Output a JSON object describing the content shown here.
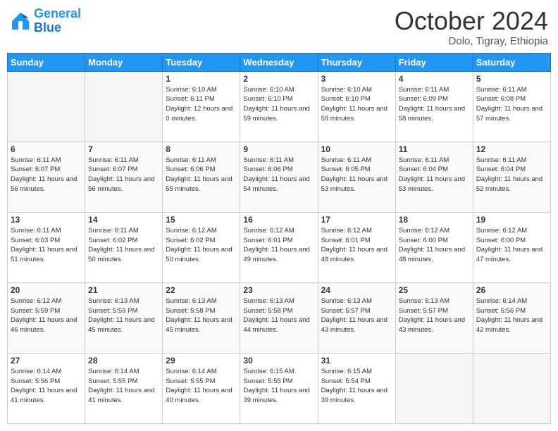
{
  "logo": {
    "line1": "General",
    "line2": "Blue"
  },
  "header": {
    "month": "October 2024",
    "location": "Dolo, Tigray, Ethiopia"
  },
  "days": [
    "Sunday",
    "Monday",
    "Tuesday",
    "Wednesday",
    "Thursday",
    "Friday",
    "Saturday"
  ],
  "weeks": [
    [
      {
        "day": "",
        "info": ""
      },
      {
        "day": "",
        "info": ""
      },
      {
        "day": "1",
        "info": "Sunrise: 6:10 AM\nSunset: 6:11 PM\nDaylight: 12 hours and 0 minutes."
      },
      {
        "day": "2",
        "info": "Sunrise: 6:10 AM\nSunset: 6:10 PM\nDaylight: 11 hours and 59 minutes."
      },
      {
        "day": "3",
        "info": "Sunrise: 6:10 AM\nSunset: 6:10 PM\nDaylight: 11 hours and 59 minutes."
      },
      {
        "day": "4",
        "info": "Sunrise: 6:11 AM\nSunset: 6:09 PM\nDaylight: 11 hours and 58 minutes."
      },
      {
        "day": "5",
        "info": "Sunrise: 6:11 AM\nSunset: 6:08 PM\nDaylight: 11 hours and 57 minutes."
      }
    ],
    [
      {
        "day": "6",
        "info": "Sunrise: 6:11 AM\nSunset: 6:07 PM\nDaylight: 11 hours and 56 minutes."
      },
      {
        "day": "7",
        "info": "Sunrise: 6:11 AM\nSunset: 6:07 PM\nDaylight: 11 hours and 56 minutes."
      },
      {
        "day": "8",
        "info": "Sunrise: 6:11 AM\nSunset: 6:06 PM\nDaylight: 11 hours and 55 minutes."
      },
      {
        "day": "9",
        "info": "Sunrise: 6:11 AM\nSunset: 6:06 PM\nDaylight: 11 hours and 54 minutes."
      },
      {
        "day": "10",
        "info": "Sunrise: 6:11 AM\nSunset: 6:05 PM\nDaylight: 11 hours and 53 minutes."
      },
      {
        "day": "11",
        "info": "Sunrise: 6:11 AM\nSunset: 6:04 PM\nDaylight: 11 hours and 53 minutes."
      },
      {
        "day": "12",
        "info": "Sunrise: 6:11 AM\nSunset: 6:04 PM\nDaylight: 11 hours and 52 minutes."
      }
    ],
    [
      {
        "day": "13",
        "info": "Sunrise: 6:11 AM\nSunset: 6:03 PM\nDaylight: 11 hours and 51 minutes."
      },
      {
        "day": "14",
        "info": "Sunrise: 6:11 AM\nSunset: 6:02 PM\nDaylight: 11 hours and 50 minutes."
      },
      {
        "day": "15",
        "info": "Sunrise: 6:12 AM\nSunset: 6:02 PM\nDaylight: 11 hours and 50 minutes."
      },
      {
        "day": "16",
        "info": "Sunrise: 6:12 AM\nSunset: 6:01 PM\nDaylight: 11 hours and 49 minutes."
      },
      {
        "day": "17",
        "info": "Sunrise: 6:12 AM\nSunset: 6:01 PM\nDaylight: 11 hours and 48 minutes."
      },
      {
        "day": "18",
        "info": "Sunrise: 6:12 AM\nSunset: 6:00 PM\nDaylight: 11 hours and 48 minutes."
      },
      {
        "day": "19",
        "info": "Sunrise: 6:12 AM\nSunset: 6:00 PM\nDaylight: 11 hours and 47 minutes."
      }
    ],
    [
      {
        "day": "20",
        "info": "Sunrise: 6:12 AM\nSunset: 5:59 PM\nDaylight: 11 hours and 46 minutes."
      },
      {
        "day": "21",
        "info": "Sunrise: 6:13 AM\nSunset: 5:59 PM\nDaylight: 11 hours and 45 minutes."
      },
      {
        "day": "22",
        "info": "Sunrise: 6:13 AM\nSunset: 5:58 PM\nDaylight: 11 hours and 45 minutes."
      },
      {
        "day": "23",
        "info": "Sunrise: 6:13 AM\nSunset: 5:58 PM\nDaylight: 11 hours and 44 minutes."
      },
      {
        "day": "24",
        "info": "Sunrise: 6:13 AM\nSunset: 5:57 PM\nDaylight: 11 hours and 43 minutes."
      },
      {
        "day": "25",
        "info": "Sunrise: 6:13 AM\nSunset: 5:57 PM\nDaylight: 11 hours and 43 minutes."
      },
      {
        "day": "26",
        "info": "Sunrise: 6:14 AM\nSunset: 5:56 PM\nDaylight: 11 hours and 42 minutes."
      }
    ],
    [
      {
        "day": "27",
        "info": "Sunrise: 6:14 AM\nSunset: 5:56 PM\nDaylight: 11 hours and 41 minutes."
      },
      {
        "day": "28",
        "info": "Sunrise: 6:14 AM\nSunset: 5:55 PM\nDaylight: 11 hours and 41 minutes."
      },
      {
        "day": "29",
        "info": "Sunrise: 6:14 AM\nSunset: 5:55 PM\nDaylight: 11 hours and 40 minutes."
      },
      {
        "day": "30",
        "info": "Sunrise: 6:15 AM\nSunset: 5:55 PM\nDaylight: 11 hours and 39 minutes."
      },
      {
        "day": "31",
        "info": "Sunrise: 6:15 AM\nSunset: 5:54 PM\nDaylight: 11 hours and 39 minutes."
      },
      {
        "day": "",
        "info": ""
      },
      {
        "day": "",
        "info": ""
      }
    ]
  ]
}
